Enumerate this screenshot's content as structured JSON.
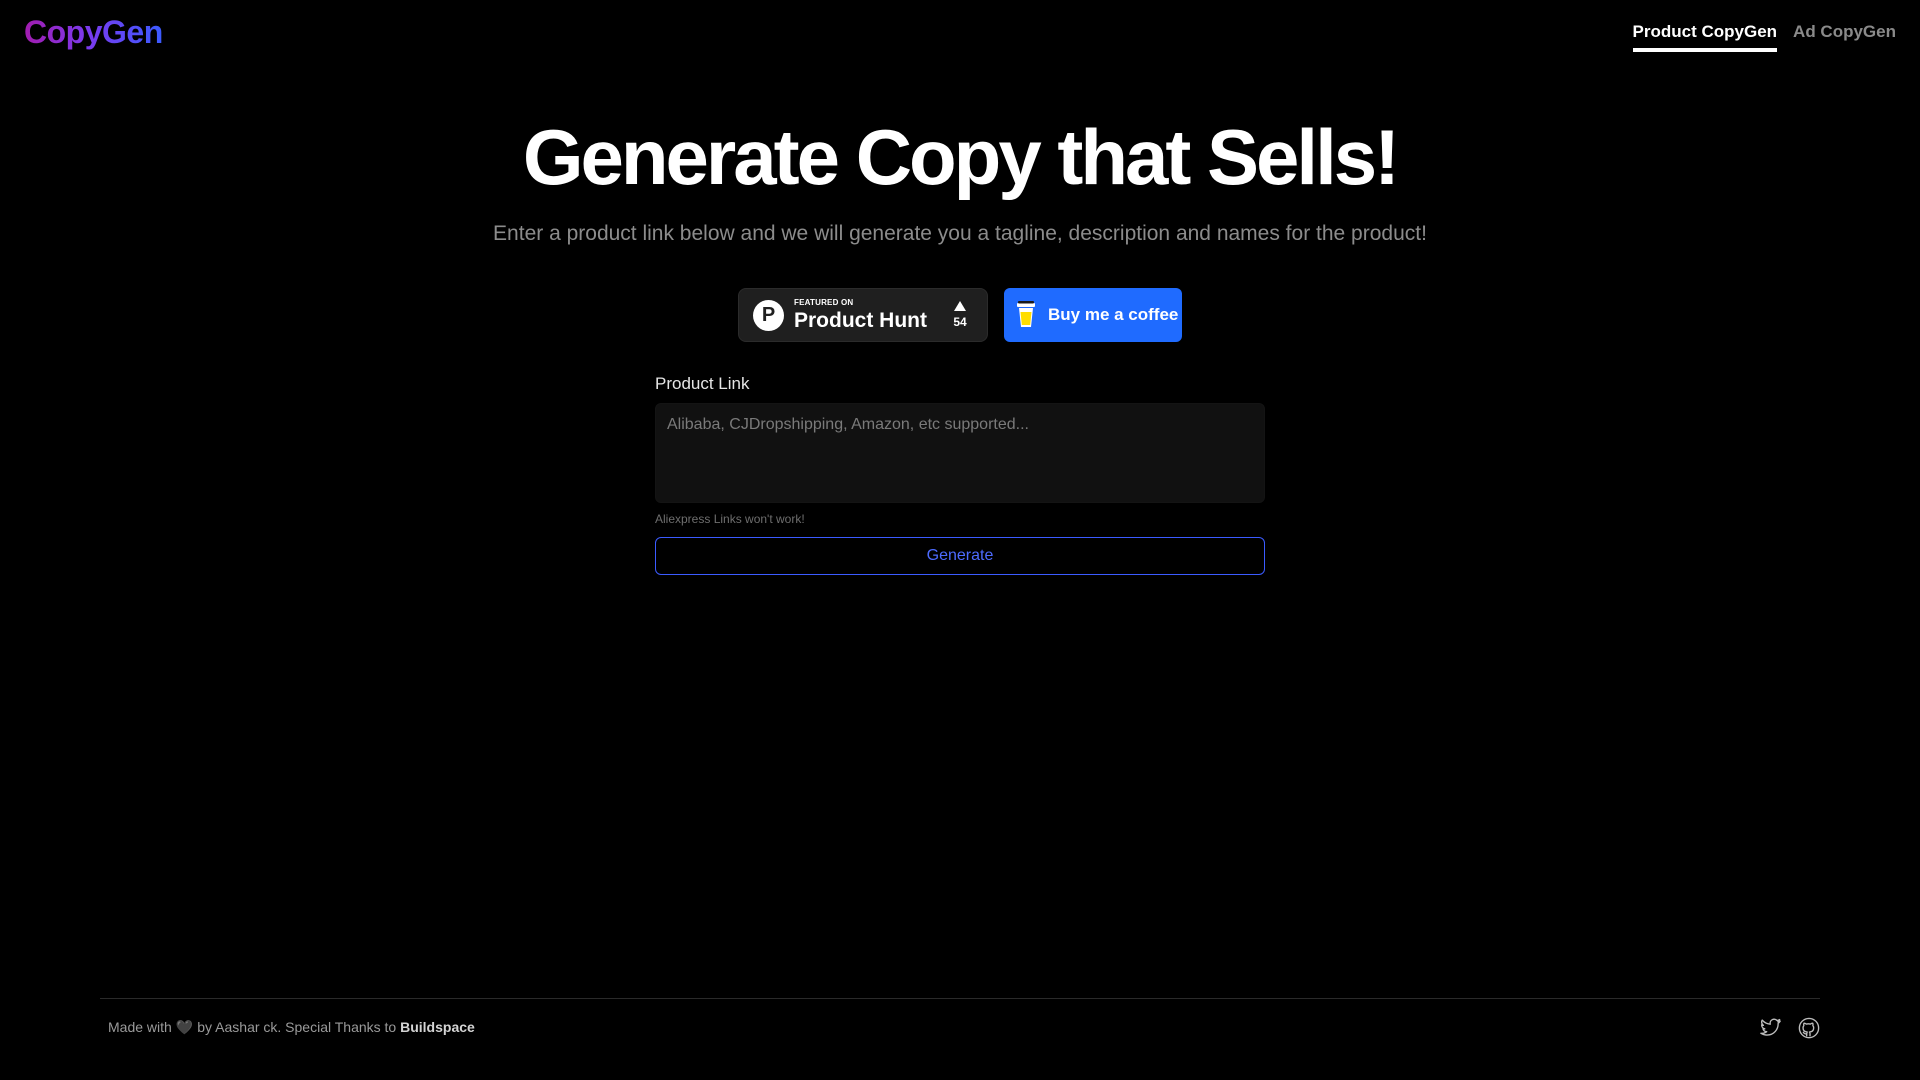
{
  "header": {
    "logo": "CopyGen",
    "tabs": [
      {
        "label": "Product CopyGen",
        "active": true
      },
      {
        "label": "Ad CopyGen",
        "active": false
      }
    ]
  },
  "hero": {
    "title": "Generate Copy that Sells!",
    "subtitle": "Enter a product link below and we will generate you a tagline, description and names for the product!"
  },
  "badges": {
    "product_hunt": {
      "small": "FEATURED ON",
      "name": "Product Hunt",
      "votes": "54",
      "icon": "product-hunt-icon"
    },
    "coffee": {
      "label": "Buy me a coffee",
      "icon": "coffee-cup-icon"
    }
  },
  "form": {
    "label": "Product Link",
    "placeholder": "Alibaba, CJDropshipping, Amazon, etc supported...",
    "value": "",
    "hint": "Aliexpress Links won't work!",
    "submit": "Generate"
  },
  "footer": {
    "made_with": "Made with",
    "heart": "🖤",
    "by": "by Aashar ck. Special Thanks to",
    "brand": "Buildspace",
    "icons": [
      "twitter-icon",
      "github-icon"
    ]
  },
  "colors": {
    "background": "#000000",
    "accent_blue": "#3b5bff",
    "coffee_button": "#1f6bff",
    "logo_gradient": [
      "#a21caf",
      "#3b5bff"
    ]
  }
}
